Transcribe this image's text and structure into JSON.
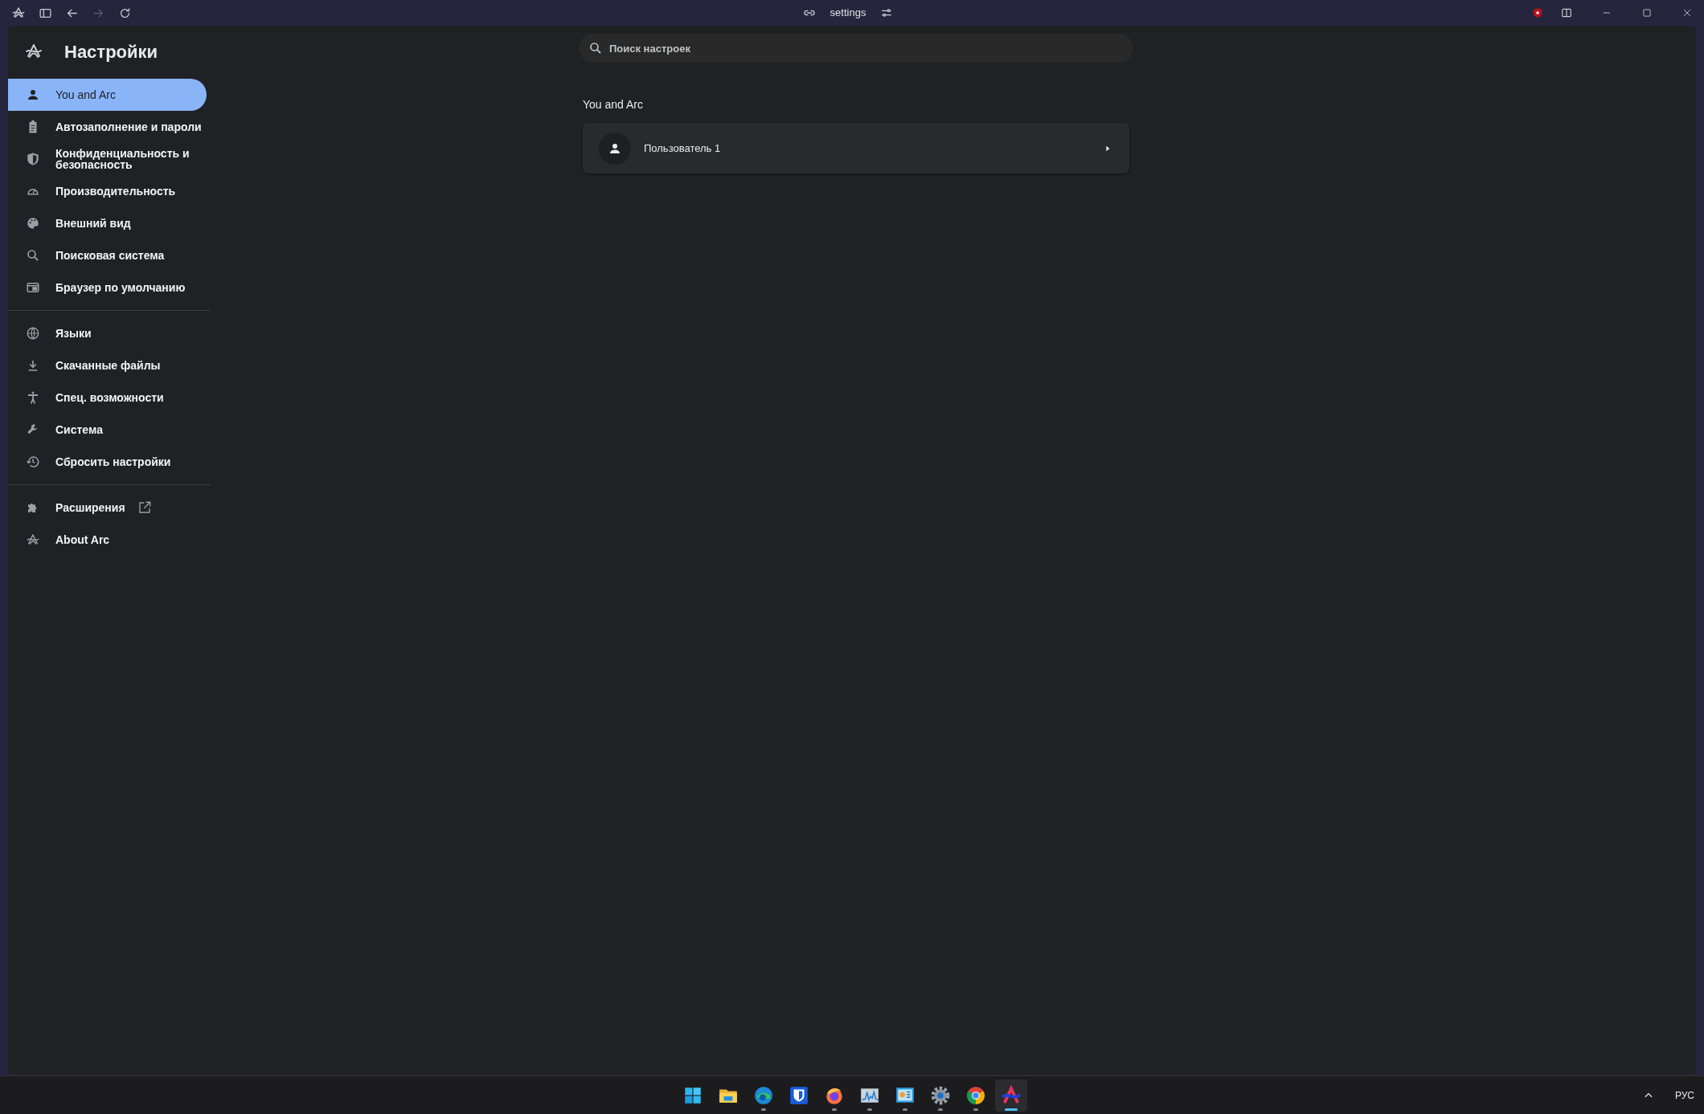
{
  "toolbar": {
    "nav": [
      {
        "kind": "sidebar",
        "disabled": false
      },
      {
        "kind": "back",
        "disabled": false
      },
      {
        "kind": "forward",
        "disabled": true
      },
      {
        "kind": "reload",
        "disabled": false
      }
    ],
    "address": "settings"
  },
  "sidebar": {
    "title": "Настройки",
    "sections": [
      [
        {
          "label": "You and Arc",
          "selected": true,
          "external": false
        },
        {
          "label": "Автозаполнение и пароли",
          "selected": false,
          "external": false
        },
        {
          "label": "Конфиденциальность и безопасность",
          "selected": false,
          "external": false
        },
        {
          "label": "Производительность",
          "selected": false,
          "external": false
        },
        {
          "label": "Внешний вид",
          "selected": false,
          "external": false
        },
        {
          "label": "Поисковая система",
          "selected": false,
          "external": false
        },
        {
          "label": "Браузер по умолчанию",
          "selected": false,
          "external": false
        }
      ],
      [
        {
          "label": "Языки",
          "selected": false,
          "external": false
        },
        {
          "label": "Скачанные файлы",
          "selected": false,
          "external": false
        },
        {
          "label": "Спец. возможности",
          "selected": false,
          "external": false
        },
        {
          "label": "Система",
          "selected": false,
          "external": false
        },
        {
          "label": "Сбросить настройки",
          "selected": false,
          "external": false
        }
      ],
      [
        {
          "label": "Расширения",
          "selected": false,
          "external": true
        },
        {
          "label": "About Arc",
          "selected": false,
          "external": false
        }
      ]
    ]
  },
  "search": {
    "placeholder": "Поиск настроек"
  },
  "section": {
    "heading": "You and Arc",
    "rows": [
      {
        "label": "Пользователь 1"
      }
    ]
  },
  "taskbar": {
    "apps": [
      {
        "running": false,
        "selected": false
      },
      {
        "running": false,
        "selected": false
      },
      {
        "running": true,
        "selected": false
      },
      {
        "running": false,
        "selected": false
      },
      {
        "running": true,
        "selected": false
      },
      {
        "running": true,
        "selected": false
      },
      {
        "running": true,
        "selected": false
      },
      {
        "running": true,
        "selected": false
      },
      {
        "running": true,
        "selected": false
      },
      {
        "running": true,
        "selected": true
      }
    ],
    "language": "РУС"
  }
}
